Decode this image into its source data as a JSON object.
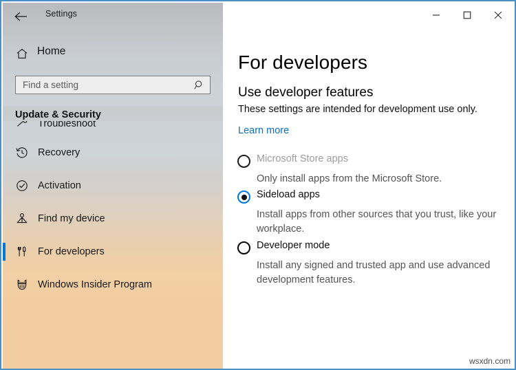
{
  "window": {
    "app_title": "Settings",
    "back_icon": "back-arrow-icon",
    "controls": {
      "minimize": "minimize-icon",
      "maximize": "maximize-icon",
      "close": "close-icon"
    },
    "accent_color": "#0078d7",
    "border_color": "#4a90c2"
  },
  "sidebar": {
    "home_label": "Home",
    "home_icon": "home-icon",
    "search": {
      "placeholder": "Find a setting",
      "value": "",
      "icon": "search-icon"
    },
    "section_header": "Update & Security",
    "items": [
      {
        "label": "Troubleshoot",
        "icon": "wrench-icon",
        "selected": false,
        "clipped": true
      },
      {
        "label": "Recovery",
        "icon": "history-clock-icon",
        "selected": false,
        "clipped": false
      },
      {
        "label": "Activation",
        "icon": "check-circle-icon",
        "selected": false,
        "clipped": false
      },
      {
        "label": "Find my device",
        "icon": "location-person-icon",
        "selected": false,
        "clipped": false
      },
      {
        "label": "For developers",
        "icon": "tools-icon",
        "selected": true,
        "clipped": false
      },
      {
        "label": "Windows Insider Program",
        "icon": "ninja-cat-icon",
        "selected": false,
        "clipped": false
      }
    ]
  },
  "main": {
    "page_title": "For developers",
    "section_title": "Use developer features",
    "intro_text": "These settings are intended for development use only.",
    "learn_more_label": "Learn more",
    "options": [
      {
        "label": "Microsoft Store apps",
        "description": "Only install apps from the Microsoft Store.",
        "selected": false,
        "disabled": true
      },
      {
        "label": "Sideload apps",
        "description": "Install apps from other sources that you trust, like your workplace.",
        "selected": true,
        "disabled": false
      },
      {
        "label": "Developer mode",
        "description": "Install any signed and trusted app and use advanced development features.",
        "selected": false,
        "disabled": false
      }
    ]
  },
  "watermark": "wsxdn.com"
}
